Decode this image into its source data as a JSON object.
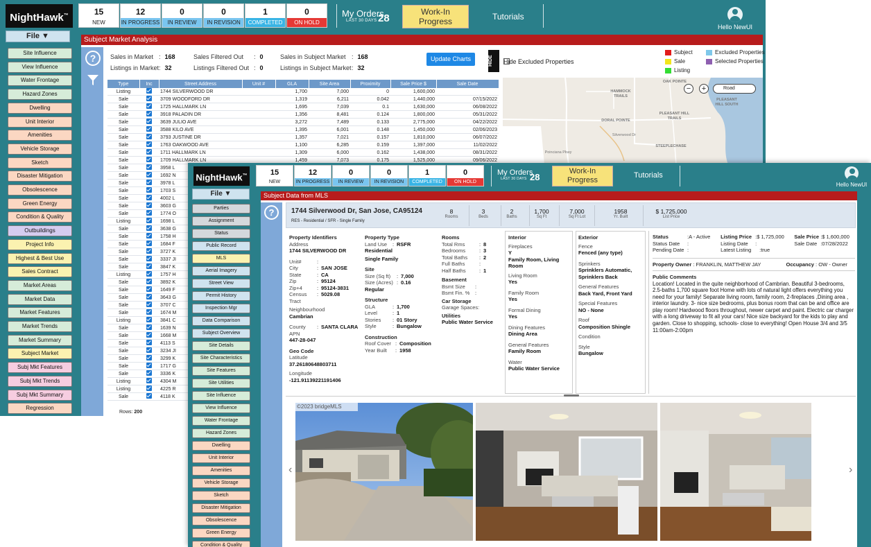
{
  "brand": "NightHawk",
  "statuses": [
    {
      "count": "15",
      "label": "NEW",
      "style": "plain"
    },
    {
      "count": "12",
      "label": "IN PROGRESS",
      "style": "blue"
    },
    {
      "count": "0",
      "label": "IN REVIEW",
      "style": "blue"
    },
    {
      "count": "0",
      "label": "IN REVISION",
      "style": "blue"
    },
    {
      "count": "1",
      "label": "COMPLETED",
      "style": "cyan"
    },
    {
      "count": "0",
      "label": "ON HOLD",
      "style": "red"
    }
  ],
  "my_orders": {
    "title": "My Orders",
    "sub": "LAST 30 DAYS",
    "count": "28"
  },
  "wip_line1": "Work-In",
  "wip_line2": "Progress",
  "tutorials": "Tutorials",
  "user": "Hello NewUI",
  "file": "File ▼",
  "w1_nav": [
    {
      "label": "Site Influence",
      "color": "#d6ecd9"
    },
    {
      "label": "View Influence",
      "color": "#d6ecd9"
    },
    {
      "label": "Water Frontage",
      "color": "#d6ecd9"
    },
    {
      "label": "Hazard Zones",
      "color": "#d6ecd9"
    },
    {
      "label": "Dwelling",
      "color": "#fbd7c2"
    },
    {
      "label": "Unit Interior",
      "color": "#fbd7c2"
    },
    {
      "label": "Amenities",
      "color": "#fbd7c2"
    },
    {
      "label": "Vehicle Storage",
      "color": "#fbd7c2"
    },
    {
      "label": "Sketch",
      "color": "#fbd7c2"
    },
    {
      "label": "Disaster Mitigation",
      "color": "#fbd7c2"
    },
    {
      "label": "Obsolescence",
      "color": "#fbd7c2"
    },
    {
      "label": "Green Energy",
      "color": "#fbd7c2"
    },
    {
      "label": "Condition & Quality",
      "color": "#fbd7c2"
    },
    {
      "label": "Outbuildings",
      "color": "#d5ccf0"
    },
    {
      "label": "Project Info",
      "color": "#fbf2b0"
    },
    {
      "label": "Highest & Best Use",
      "color": "#fbf2b0"
    },
    {
      "label": "Sales Contract",
      "color": "#fbf2b0"
    },
    {
      "label": "Market Areas",
      "color": "#d6ecd9"
    },
    {
      "label": "Market Data",
      "color": "#d6ecd9"
    },
    {
      "label": "Market Features",
      "color": "#d6ecd9"
    },
    {
      "label": "Market Trends",
      "color": "#d6ecd9"
    },
    {
      "label": "Market Summary",
      "color": "#d6ecd9"
    },
    {
      "label": "Subject Market",
      "color": "#fbf2b0"
    },
    {
      "label": "Subj Mkt Features",
      "color": "#f6cde0"
    },
    {
      "label": "Subj Mkt Trends",
      "color": "#f6cde0"
    },
    {
      "label": "Subj Mkt Summary",
      "color": "#f6cde0"
    },
    {
      "label": "Regression",
      "color": "#fbd7c2"
    }
  ],
  "w2_nav": [
    {
      "label": "Parties",
      "color": "#d4d8dc"
    },
    {
      "label": "Assignment",
      "color": "#d4d8dc"
    },
    {
      "label": "Status",
      "color": "#d4d8dc"
    },
    {
      "label": "Public Record",
      "color": "#cfe3ef"
    },
    {
      "label": "MLS",
      "color": "#fbf2b0"
    },
    {
      "label": "Aerial Imagery",
      "color": "#cfe3ef"
    },
    {
      "label": "Street View",
      "color": "#cfe3ef"
    },
    {
      "label": "Permit History",
      "color": "#cfe3ef"
    },
    {
      "label": "Inspection Mgr",
      "color": "#cfe3ef"
    },
    {
      "label": "Data Comparison",
      "color": "#cfe3ef"
    },
    {
      "label": "Subject Overview",
      "color": "#cfe3ef"
    },
    {
      "label": "Site Details",
      "color": "#d6ecd9"
    },
    {
      "label": "Site Characteristics",
      "color": "#d6ecd9"
    },
    {
      "label": "Site Features",
      "color": "#d6ecd9"
    },
    {
      "label": "Site Utilities",
      "color": "#d6ecd9"
    },
    {
      "label": "Site Influence",
      "color": "#d6ecd9"
    },
    {
      "label": "View Influence",
      "color": "#d6ecd9"
    },
    {
      "label": "Water Frontage",
      "color": "#d6ecd9"
    },
    {
      "label": "Hazard Zones",
      "color": "#d6ecd9"
    },
    {
      "label": "Dwelling",
      "color": "#fbd7c2"
    },
    {
      "label": "Unit Interior",
      "color": "#fbd7c2"
    },
    {
      "label": "Amenities",
      "color": "#fbd7c2"
    },
    {
      "label": "Vehicle Storage",
      "color": "#fbd7c2"
    },
    {
      "label": "Sketch",
      "color": "#fbd7c2"
    },
    {
      "label": "Disaster Mitigation",
      "color": "#fbd7c2"
    },
    {
      "label": "Obsolescence",
      "color": "#fbd7c2"
    },
    {
      "label": "Green Energy",
      "color": "#fbd7c2"
    },
    {
      "label": "Condition & Quality",
      "color": "#fbd7c2"
    }
  ],
  "sma": {
    "title": "Subject Market Analysis",
    "stats": [
      {
        "label": "Sales in Market",
        "colon": ":",
        "value": "168"
      },
      {
        "label": "Sales Filtered Out",
        "colon": ":",
        "value": "0"
      },
      {
        "label": "Sales in Subject Market",
        "colon": ":",
        "value": "168"
      },
      {
        "label": "Listings in Market",
        "colon": ":",
        "value": "32"
      },
      {
        "label": "Listings Filtered Out",
        "colon": ":",
        "value": "0"
      },
      {
        "label": "Listings in Subject Market",
        "colon": ":",
        "value": "32"
      }
    ],
    "update_btn": "Update Charts",
    "hide": "HIDE",
    "hide_excluded": "Hide Excluded Properties",
    "legend": [
      {
        "label": "Subject",
        "color": "#e21b1b"
      },
      {
        "label": "Excluded Properties",
        "color": "#7fc8ea"
      },
      {
        "label": "Sale",
        "color": "#f2e51c"
      },
      {
        "label": "Selected Properties",
        "color": "#8e5fb0"
      },
      {
        "label": "Listing",
        "color": "#33dd33"
      }
    ],
    "columns": [
      "Type",
      "Inc",
      "Street Address",
      "Unit #",
      "GLA",
      "Site Area",
      "Proximity",
      "Sale Price $",
      "Sale Date"
    ],
    "rows": [
      [
        "Listing",
        "1744 SILVERWOOD DR",
        "",
        "1,700",
        "7,000",
        "0",
        "1,600,000",
        ""
      ],
      [
        "Sale",
        "3709 WOODFORD DR",
        "",
        "1,319",
        "6,211",
        "0.042",
        "1,440,000",
        "07/15/2022"
      ],
      [
        "Sale",
        "1725 HALLMARK LN",
        "",
        "1,695",
        "7,039",
        "0.1",
        "1,630,000",
        "06/08/2022"
      ],
      [
        "Sale",
        "3918 PALADIN DR",
        "",
        "1,356",
        "8,481",
        "0.124",
        "1,800,000",
        "05/31/2022"
      ],
      [
        "Sale",
        "3639 JULIO AVE",
        "",
        "3,272",
        "7,489",
        "0.133",
        "2,775,000",
        "04/22/2022"
      ],
      [
        "Sale",
        "3588 KILO AVE",
        "",
        "1,395",
        "6,001",
        "0.148",
        "1,450,000",
        "02/06/2023"
      ],
      [
        "Sale",
        "3793 JUSTINE DR",
        "",
        "1,357",
        "7,021",
        "0.157",
        "1,810,000",
        "06/07/2022"
      ],
      [
        "Sale",
        "1763 OAKWOOD AVE",
        "",
        "1,100",
        "6,285",
        "0.159",
        "1,397,000",
        "11/02/2022"
      ],
      [
        "Sale",
        "1711 HALLMARK LN",
        "",
        "1,309",
        "6,000",
        "0.162",
        "1,438,000",
        "08/31/2022"
      ],
      [
        "Sale",
        "1709 HALLMARK LN",
        "",
        "1,459",
        "7,073",
        "0.175",
        "1,525,000",
        "09/06/2022"
      ],
      [
        "Sale",
        "3958 L",
        "",
        "",
        "",
        "",
        "",
        ""
      ],
      [
        "Sale",
        "1692 N",
        "",
        "",
        "",
        "",
        "",
        ""
      ],
      [
        "Sale",
        "3978 L",
        "",
        "",
        "",
        "",
        "",
        ""
      ],
      [
        "Sale",
        "1703 S",
        "",
        "",
        "",
        "",
        "",
        ""
      ],
      [
        "Sale",
        "4002 L",
        "",
        "",
        "",
        "",
        "",
        ""
      ],
      [
        "Sale",
        "3603 G",
        "",
        "",
        "",
        "",
        "",
        ""
      ],
      [
        "Sale",
        "1774 O",
        "",
        "",
        "",
        "",
        "",
        ""
      ],
      [
        "Listing",
        "1698 L",
        "",
        "",
        "",
        "",
        "",
        ""
      ],
      [
        "Sale",
        "3638 G",
        "",
        "",
        "",
        "",
        "",
        ""
      ],
      [
        "Sale",
        "1758 H",
        "",
        "",
        "",
        "",
        "",
        ""
      ],
      [
        "Sale",
        "1684 F",
        "",
        "",
        "",
        "",
        "",
        ""
      ],
      [
        "Sale",
        "3727 K",
        "",
        "",
        "",
        "",
        "",
        ""
      ],
      [
        "Sale",
        "3337 JI",
        "",
        "",
        "",
        "",
        "",
        ""
      ],
      [
        "Sale",
        "3847 K",
        "",
        "",
        "",
        "",
        "",
        ""
      ],
      [
        "Listing",
        "1757 H",
        "",
        "",
        "",
        "",
        "",
        ""
      ],
      [
        "Sale",
        "3892 K",
        "",
        "",
        "",
        "",
        "",
        ""
      ],
      [
        "Sale",
        "1649 F",
        "",
        "",
        "",
        "",
        "",
        ""
      ],
      [
        "Sale",
        "3643 G",
        "",
        "",
        "",
        "",
        "",
        ""
      ],
      [
        "Sale",
        "3707 C",
        "",
        "",
        "",
        "",
        "",
        ""
      ],
      [
        "Sale",
        "1674 M",
        "",
        "",
        "",
        "",
        "",
        ""
      ],
      [
        "Listing",
        "3841 C",
        "",
        "",
        "",
        "",
        "",
        ""
      ],
      [
        "Sale",
        "1639 N",
        "",
        "",
        "",
        "",
        "",
        ""
      ],
      [
        "Sale",
        "1668 M",
        "",
        "",
        "",
        "",
        "",
        ""
      ],
      [
        "Sale",
        "4113 S",
        "",
        "",
        "",
        "",
        "",
        ""
      ],
      [
        "Sale",
        "3234 JI",
        "",
        "",
        "",
        "",
        "",
        ""
      ],
      [
        "Sale",
        "3299 K",
        "",
        "",
        "",
        "",
        "",
        ""
      ],
      [
        "Sale",
        "1717 G",
        "",
        "",
        "",
        "",
        "",
        ""
      ],
      [
        "Sale",
        "3336 K",
        "",
        "",
        "",
        "",
        "",
        ""
      ],
      [
        "Listing",
        "4304 M",
        "",
        "",
        "",
        "",
        "",
        ""
      ],
      [
        "Listing",
        "4225 R",
        "",
        "",
        "",
        "",
        "",
        ""
      ],
      [
        "Sale",
        "4118 K",
        "",
        "",
        "",
        "",
        "",
        ""
      ]
    ],
    "rows_label": "Rows:",
    "rows_count": "200",
    "map": {
      "labels": [
        {
          "t": "HAMMOCK TRAILS"
        },
        {
          "t": "OAK POINTE"
        },
        {
          "t": "PLEASANT HILL SOUTH"
        },
        {
          "t": "DORAL POINTE"
        },
        {
          "t": "PLEASANT HILL TRAILS"
        },
        {
          "t": "STEEPLECHASE"
        },
        {
          "t": "Poinciana Pkwy"
        },
        {
          "t": "Silverwood Dr"
        }
      ],
      "select": "Road",
      "zoom_out": "−",
      "zoom_in": "+"
    }
  },
  "mls": {
    "title": "Subject Data from MLS",
    "address": "1744 Silverwood Dr, San Jose, CA95124",
    "subtype": "RES - Residential / SFR - Single Family",
    "metrics": [
      {
        "v": "8",
        "l": "Rooms"
      },
      {
        "v": "3",
        "l": "Beds"
      },
      {
        "v": "2",
        "l": "Baths"
      },
      {
        "v": "1,700",
        "l": "Sq Ft"
      },
      {
        "v": "7,000",
        "l": "Sq Ft Lot"
      },
      {
        "v": "1958",
        "l": "Yr. Built"
      },
      {
        "v": "$ 1,725,000",
        "l": "List Price"
      }
    ],
    "pid": {
      "h": "Property Identifiers",
      "address_l": "Address",
      "address_v": "1744 SILVERWOOD DR",
      "unit_l": "Unit#",
      "unit_v": "",
      "city_l": "City",
      "city_v": "SAN JOSE",
      "state_l": "State",
      "state_v": "CA",
      "zip_l": "Zip",
      "zip_v": "95124",
      "zip4_l": "Zip+4",
      "zip4_v": "95124-3831",
      "census_l": "Census Tract",
      "census_v": "5029.08",
      "nb_l": "Neighbourhood",
      "nb_v": "Cambrian",
      "county_l": "County",
      "county_v": "SANTA CLARA",
      "apn_l": "APN",
      "apn_v": "447-28-047",
      "geo_h": "Geo Code",
      "lat_l": "Latitude",
      "lat_v": "37.26180648803711",
      "lon_l": "Longitude",
      "lon_v": "-121.91139221191406"
    },
    "ptype": {
      "h": "Property Type",
      "landuse_l": "Land Use",
      "landuse_v": "RSFR",
      "landuse_v2": "Residential",
      "landuse_v3": "Single Family",
      "site_h": "Site",
      "size_l": "Size (Sq ft)",
      "size_v": "7,000",
      "acres_l": "Size (Acres)",
      "acres_v": "0.16",
      "shape_v": "Regular",
      "struct_h": "Structure",
      "gla_l": "GLA",
      "gla_v": "1,700",
      "level_l": "Level",
      "level_v": "1",
      "stories_l": "Stories",
      "stories_v": "01 Story",
      "style_l": "Style",
      "style_v": "Bungalow",
      "cons_h": "Construction",
      "roof_l": "Roof Cover",
      "roof_v": "Composition",
      "yb_l": "Year Built",
      "yb_v": "1958"
    },
    "rooms": {
      "h": "Rooms",
      "total_l": "Total Rms",
      "total_v": "8",
      "bed_l": "Bedrooms",
      "bed_v": "3",
      "tb_l": "Total Baths",
      "tb_v": "2",
      "fb_l": "Full Baths",
      "fb_v": "",
      "hb_l": "Half Baths",
      "hb_v": "1",
      "base_h": "Basement",
      "bsmt_l": "Bsmt Size",
      "bsmt_v": "",
      "bfin_l": "Bsmt Fin. %",
      "bfin_v": "",
      "car_h": "Car Storage",
      "gar_l": "Garage Spaces:",
      "util_h": "Utilities",
      "util_v": "Public Water Service"
    },
    "interior": {
      "h": "Interior",
      "fp_l": "Fireplaces",
      "fp_v": "Y",
      "fp_v2": "Family Room, Living Room",
      "lr_l": "Living Room",
      "lr_v": "Yes",
      "fr_l": "Family Room",
      "fr_v": "Yes",
      "fd_l": "Formal Dining",
      "fd_v": "Yes",
      "df_l": "Dining Features",
      "df_v": "Dining Area",
      "gf_l": "General Features",
      "gf_v": "Family Room",
      "w_l": "Water",
      "w_v": "Public Water Service"
    },
    "exterior": {
      "h": "Exterior",
      "fence_l": "Fence",
      "fence_v": "Fenced (any type)",
      "spr_l": "Sprinkers",
      "spr_v": "Sprinklers Automatic, Sprinklers Back",
      "gf_l": "General Features",
      "gf_v": "Back Yard, Front Yard",
      "sf_l": "Special Features",
      "sf_v": "NO - None",
      "roof_l": "Roof",
      "roof_v": "Composition Shingle",
      "cond_l": "Condition",
      "style_l": "Style",
      "style_v": "Bungalow"
    },
    "status": {
      "status_l": "Status",
      "status_v": "A - Active",
      "lp_l": "Listing Price",
      "lp_v": "$ 1,725,000",
      "sp_l": "Sale Price",
      "sp_v": "$ 1,600,000",
      "sd_l": "Status Date",
      "ld_l": "Listing Date",
      "sald_l": "Sale Date",
      "sald_v": "07/28/2022",
      "pd_l": "Pending Date",
      "ll_l": "Latest Listing",
      "ll_v": "true",
      "owner_l": "Property Owner",
      "owner_v": "FRANKLIN, MATTHEW JAY",
      "occ_l": "Occupancy",
      "occ_v": "OW - Owner",
      "pc_h": "Public Comments",
      "pc": "Location! Located in the quite neighborhood of Cambrian. Beautiful 3-bedrooms, 2.5-baths 1,700 square foot Home with lots of natural light offers everything you need for your family! Separate living room, family room, 2-fireplaces ,Dining area , interior laundry. 3- nice size bedrooms, plus bonus room that can be and office are play room! Hardwood floors throughout, newer carpet and paint. Electric car charger with a long driveway to fit all your cars! Nice size backyard for the kids to play and garden. Close to shopping, schools- close to everything! Open House 3/4 and 3/5 11:00am-2:00pm"
    },
    "photo_credit": "©2023 bridgeMLS"
  }
}
